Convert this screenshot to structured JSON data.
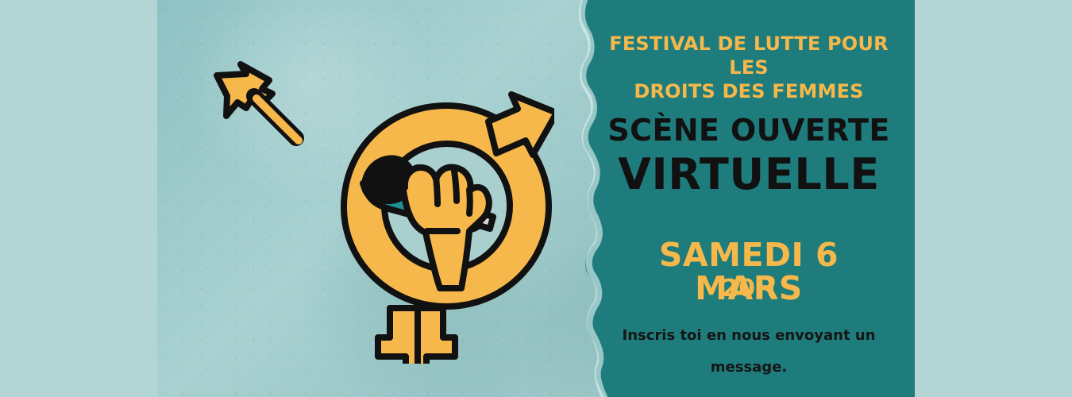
{
  "poster": {
    "festival_line1": "FESTIVAL DE LUTTE POUR LES",
    "festival_line2": "DROITS DES FEMMES",
    "title_line1": "SCÈNE OUVERTE",
    "title_line2": "VIRTUELLE",
    "date": "SAMEDI 6 MARS",
    "time": "20H",
    "cta_line1": "Inscris toi en nous envoyant un",
    "cta_line2": "message."
  },
  "colors": {
    "background": "#b3d6d4",
    "panel_dark": "#1f7c7d",
    "accent_orange": "#f6b84a",
    "text_dark": "#111111"
  },
  "icons": {
    "emblem": "raised-fist-microphone-symbol",
    "logo": "mascot-logo"
  }
}
